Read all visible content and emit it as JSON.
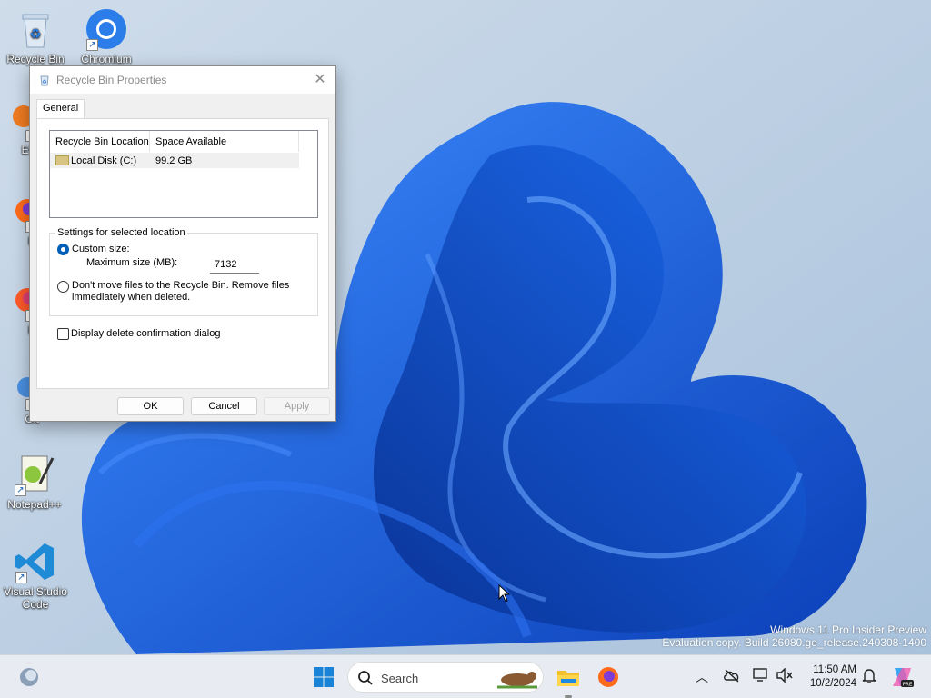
{
  "desktop": {
    "icons": [
      {
        "label": "Recycle Bin",
        "icon": "recycle-bin-icon"
      },
      {
        "label": "Chromium",
        "icon": "chromium-icon"
      },
      {
        "label": "Eve",
        "icon": "app-icon"
      },
      {
        "label": "Fi",
        "icon": "firefox-icon"
      },
      {
        "label": "Fi",
        "icon": "firefox-icon"
      },
      {
        "label": "Git",
        "icon": "git-icon"
      },
      {
        "label": "Notepad++",
        "icon": "notepad-plus-plus-icon"
      },
      {
        "label": "Visual Studio Code",
        "icon": "vscode-icon"
      }
    ]
  },
  "dialog": {
    "title": "Recycle Bin Properties",
    "tab": "General",
    "list": {
      "columns": [
        "Recycle Bin Location",
        "Space Available"
      ],
      "rows": [
        {
          "location": "Local Disk (C:)",
          "space": "99.2 GB"
        }
      ]
    },
    "settings": {
      "legend": "Settings for selected location",
      "custom_size_label": "Custom size:",
      "max_size_label": "Maximum size (MB):",
      "max_size_value": "7132",
      "dont_move_label_1": "Don't move files to the Recycle Bin. Remove files",
      "dont_move_label_2": "immediately when deleted."
    },
    "confirm_label": "Display delete confirmation dialog",
    "buttons": {
      "ok": "OK",
      "cancel": "Cancel",
      "apply": "Apply"
    }
  },
  "watermark": {
    "line1": "Windows 11 Pro Insider Preview",
    "line2": "Evaluation copy. Build 26080.ge_release.240308-1400"
  },
  "taskbar": {
    "search_placeholder": "Search",
    "time": "11:50 AM",
    "date": "10/2/2024"
  },
  "colors": {
    "accent": "#005fb8",
    "wallpaper_bloom": "#1a5fd8",
    "taskbar": "#e8ecf2"
  }
}
